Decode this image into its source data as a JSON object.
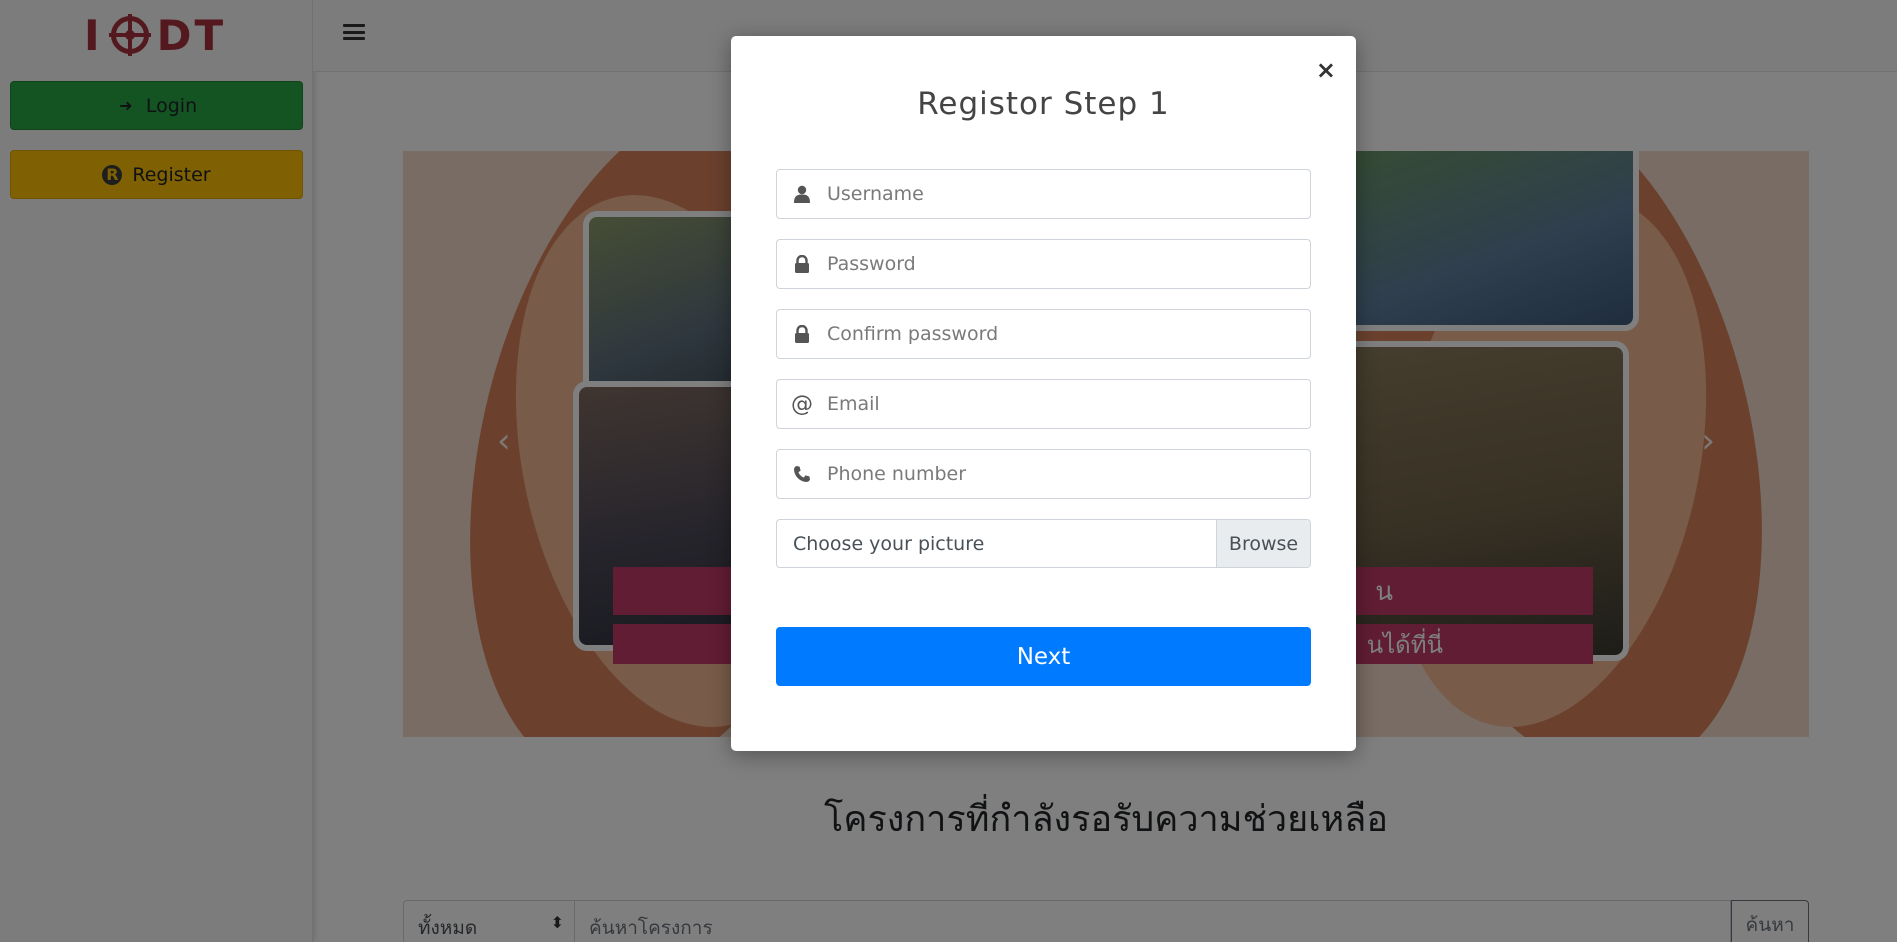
{
  "sidebar": {
    "logo_text": "IDT",
    "login_label": "Login",
    "register_label": "Register"
  },
  "carousel": {
    "caption_line1": "น",
    "caption_line2": "นได้ที่นี่"
  },
  "main": {
    "section_title": "โครงการที่กำลังรอรับความช่วยเหลือ",
    "search": {
      "filter_value": "ทั้งหมด",
      "placeholder": "ค้นหาโครงการ",
      "button_label": "ค้นหา"
    }
  },
  "modal": {
    "title": "Registor Step 1",
    "close_label": "×",
    "fields": {
      "username_placeholder": "Username",
      "password_placeholder": "Password",
      "confirm_placeholder": "Confirm password",
      "email_placeholder": "Email",
      "phone_placeholder": "Phone number",
      "file_label": "Choose your picture",
      "browse_label": "Browse"
    },
    "next_label": "Next"
  },
  "colors": {
    "login_green": "#28a745",
    "register_yellow": "#ffc107",
    "primary_blue": "#007bff",
    "logo_red": "#a8323e",
    "caption_pink": "#c23b67"
  }
}
